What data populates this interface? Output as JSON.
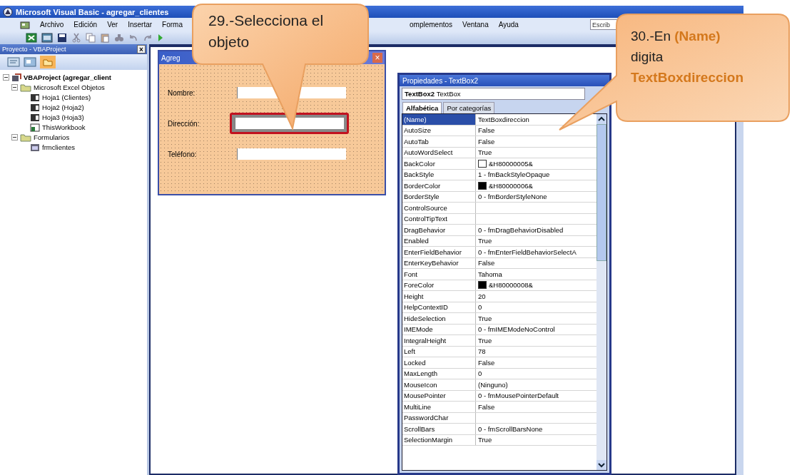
{
  "window": {
    "title": "Microsoft Visual Basic - agregar_clientes"
  },
  "menu_left": [
    "Archivo",
    "Edición",
    "Ver",
    "Insertar",
    "Forma"
  ],
  "menu_right": [
    "omplementos",
    "Ventana",
    "Ayuda"
  ],
  "help_field": {
    "placeholder": "Escrib"
  },
  "project_pane": {
    "title": "Proyecto - VBAProject",
    "close": "×",
    "tree": [
      {
        "label": "VBAProject (agregar_client",
        "kind": "project",
        "expanded": true,
        "children": [
          {
            "label": "Microsoft Excel Objetos",
            "kind": "folder",
            "expanded": true,
            "children": [
              {
                "label": "Hoja1 (Clientes)",
                "kind": "sheet"
              },
              {
                "label": "Hoja2 (Hoja2)",
                "kind": "sheet"
              },
              {
                "label": "Hoja3 (Hoja3)",
                "kind": "sheet"
              },
              {
                "label": "ThisWorkbook",
                "kind": "workbook"
              }
            ]
          },
          {
            "label": "Formularios",
            "kind": "folder",
            "expanded": true,
            "children": [
              {
                "label": "frmclientes",
                "kind": "form"
              }
            ]
          }
        ]
      }
    ]
  },
  "form_window": {
    "title": "Agreg",
    "close": "×",
    "fields": [
      {
        "label": "Nombre:",
        "selected": false
      },
      {
        "label": "Dirección:",
        "selected": true
      },
      {
        "label": "Teléfono:",
        "selected": false
      }
    ]
  },
  "properties": {
    "title": "Propiedades - TextBox2",
    "object_name": "TextBox2",
    "object_type": "TextBox",
    "tabs": [
      {
        "label": "Alfabética",
        "selected": true
      },
      {
        "label": "Por categorías",
        "selected": false
      }
    ],
    "rows": [
      {
        "name": "(Name)",
        "value": "TextBoxdireccion",
        "selected": true
      },
      {
        "name": "AutoSize",
        "value": "False",
        "selected": false
      },
      {
        "name": "AutoTab",
        "value": "False",
        "selected": false
      },
      {
        "name": "AutoWordSelect",
        "value": "True",
        "selected": false
      },
      {
        "name": "BackColor",
        "value": "&H80000005&",
        "color": "#ffffff",
        "selected": false
      },
      {
        "name": "BackStyle",
        "value": "1 - fmBackStyleOpaque",
        "selected": false
      },
      {
        "name": "BorderColor",
        "value": "&H80000006&",
        "color": "#000000",
        "selected": false
      },
      {
        "name": "BorderStyle",
        "value": "0 - fmBorderStyleNone",
        "selected": false
      },
      {
        "name": "ControlSource",
        "selected": false
      },
      {
        "name": "ControlTipText",
        "selected": false
      },
      {
        "name": "DragBehavior",
        "value": "0 - fmDragBehaviorDisabled",
        "selected": false
      },
      {
        "name": "Enabled",
        "value": "True",
        "selected": false
      },
      {
        "name": "EnterFieldBehavior",
        "value": "0 - fmEnterFieldBehaviorSelectA",
        "selected": false
      },
      {
        "name": "EnterKeyBehavior",
        "value": "False",
        "selected": false
      },
      {
        "name": "Font",
        "value": "Tahoma",
        "selected": false
      },
      {
        "name": "ForeColor",
        "value": "&H80000008&",
        "color": "#000000",
        "selected": false
      },
      {
        "name": "Height",
        "value": "20",
        "selected": false
      },
      {
        "name": "HelpContextID",
        "value": "0",
        "selected": false
      },
      {
        "name": "HideSelection",
        "value": "True",
        "selected": false
      },
      {
        "name": "IMEMode",
        "value": "0 - fmIMEModeNoControl",
        "selected": false
      },
      {
        "name": "IntegralHeight",
        "value": "True",
        "selected": false
      },
      {
        "name": "Left",
        "value": "78",
        "selected": false
      },
      {
        "name": "Locked",
        "value": "False",
        "selected": false
      },
      {
        "name": "MaxLength",
        "value": "0",
        "selected": false
      },
      {
        "name": "MouseIcon",
        "value": "(Ninguno)",
        "selected": false
      },
      {
        "name": "MousePointer",
        "value": "0 - fmMousePointerDefault",
        "selected": false
      },
      {
        "name": "MultiLine",
        "value": "False",
        "selected": false
      },
      {
        "name": "PasswordChar",
        "selected": false
      },
      {
        "name": "ScrollBars",
        "value": "0 - fmScrollBarsNone",
        "selected": false
      },
      {
        "name": "SelectionMargin",
        "value": "True",
        "selected": false
      }
    ]
  },
  "callouts": [
    {
      "lines": [
        "29.-Selecciona el",
        "objeto"
      ]
    },
    {
      "lines": [
        "30.-En **(Name)**",
        "digita",
        "**TextBoxdireccion**"
      ]
    }
  ]
}
